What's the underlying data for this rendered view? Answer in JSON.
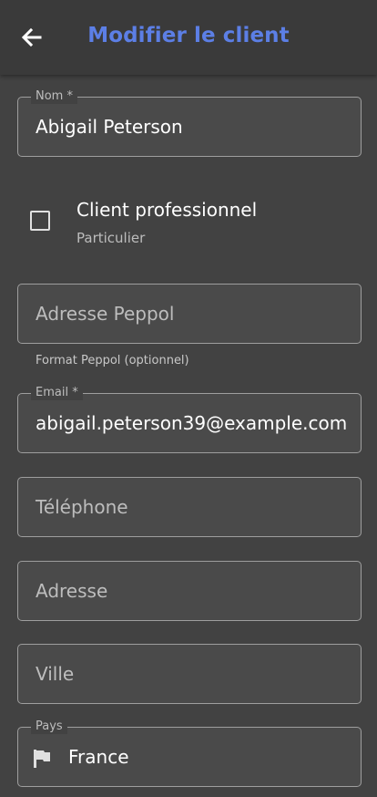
{
  "appbar": {
    "title": "Modifier le client"
  },
  "fields": {
    "name": {
      "label": "Nom *",
      "value": "Abigail Peterson"
    },
    "professional": {
      "label": "Client professionnel",
      "subtitle": "Particulier",
      "checked": false
    },
    "peppol": {
      "placeholder": "Adresse Peppol",
      "helper": "Format Peppol (optionnel)"
    },
    "email": {
      "label": "Email *",
      "value": "abigail.peterson39@example.com"
    },
    "phone": {
      "placeholder": "Téléphone"
    },
    "address": {
      "placeholder": "Adresse"
    },
    "city": {
      "placeholder": "Ville"
    },
    "country": {
      "label": "Pays",
      "value": "France",
      "icon": "flag-icon"
    }
  },
  "colors": {
    "accent": "#5c7fe6",
    "background": "#424242",
    "appbar": "#3a3a3a"
  }
}
